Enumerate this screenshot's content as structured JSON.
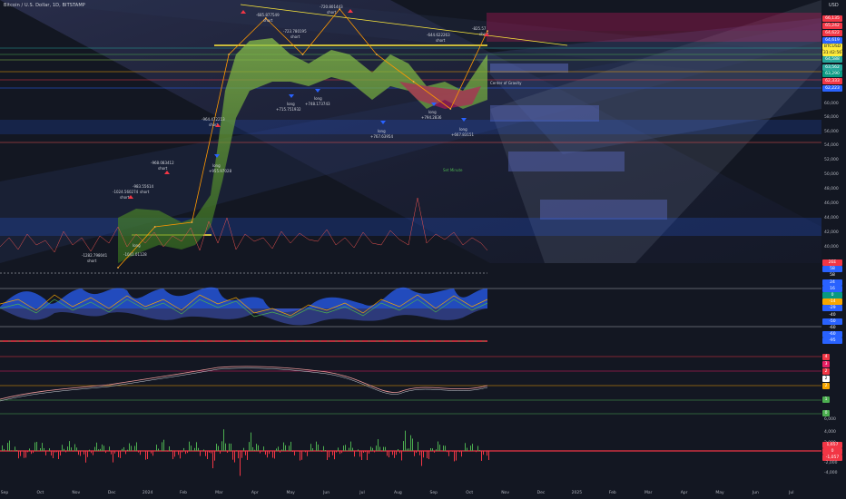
{
  "title": "Bitcoin / U.S. Dollar, 1D, BITSTAMP",
  "currency": "USD",
  "badges": [
    {
      "text": "66,135",
      "color": "#f23645"
    },
    {
      "text": "65,242",
      "color": "#f23645"
    },
    {
      "text": "64,622",
      "color": "#f23645"
    },
    {
      "text": "64,619",
      "color": "#2962ff"
    },
    {
      "text": "BTCUSD",
      "color": "#131722"
    },
    {
      "text": "64,588",
      "color": "#26a69a"
    },
    {
      "text": "63,562",
      "color": "#26a69a"
    },
    {
      "text": "63,290",
      "color": "#089981"
    },
    {
      "text": "62,333",
      "color": "#f23645"
    },
    {
      "text": "62,223",
      "color": "#2962ff"
    }
  ],
  "timer": "31:42:56",
  "price_ticks": [
    "60,000",
    "58,000",
    "56,000",
    "54,000",
    "52,000",
    "50,000",
    "48,000",
    "46,000",
    "44,000",
    "42,000",
    "40,000"
  ],
  "osc_badges": [
    {
      "text": "2EE",
      "color": "#f23645"
    },
    {
      "text": "58",
      "color": "#2962ff"
    },
    {
      "text": "58",
      "color": "#131722"
    },
    {
      "text": "24",
      "color": "#2962ff"
    },
    {
      "text": "16",
      "color": "#2962ff"
    },
    {
      "text": "0",
      "color": "#089981"
    },
    {
      "text": "-14",
      "color": "#f7a600"
    },
    {
      "text": "-29",
      "color": "#2962ff"
    },
    {
      "text": "-40",
      "color": "#131722"
    },
    {
      "text": "-50",
      "color": "#2962ff"
    },
    {
      "text": "-60",
      "color": "#131722"
    },
    {
      "text": "-60",
      "color": "#2962ff"
    },
    {
      "text": "-95",
      "color": "#2962ff"
    }
  ],
  "num_badges": [
    {
      "text": "4",
      "color": "#f23645"
    },
    {
      "text": "3",
      "color": "#e91e63"
    },
    {
      "text": "2",
      "color": "#f23645"
    },
    {
      "text": "2",
      "color": "#ffffff"
    },
    {
      "text": "2",
      "color": "#f7a600"
    },
    {
      "text": "1",
      "color": "#4caf50"
    },
    {
      "text": "0",
      "color": "#4caf50"
    }
  ],
  "vol_ticks": [
    "4,000",
    "2,000",
    "0",
    "-2,000",
    "-4,000"
  ],
  "vol_badges": [
    {
      "text": "1,657",
      "color": "#f23645"
    },
    {
      "text": "0",
      "color": "#f23645"
    },
    {
      "text": "-1,057",
      "color": "#f23645"
    }
  ],
  "stoch_tick": "6,000",
  "x_ticks": [
    "Sep",
    "Oct",
    "Nov",
    "Dec",
    "2024",
    "Feb",
    "Mar",
    "Apr",
    "May",
    "Jun",
    "Jul",
    "Aug",
    "Sep",
    "Oct",
    "Nov",
    "Dec",
    "2025",
    "Feb",
    "Mar",
    "Apr",
    "May",
    "Jun",
    "Jul"
  ],
  "annotations": [
    {
      "text": "short",
      "a": "-1282.798041"
    },
    {
      "text": "short",
      "a": "-1024.560274"
    },
    {
      "text": "short",
      "a": "-983.55614"
    },
    {
      "text": "short",
      "a": "-968.083412"
    },
    {
      "text": "short",
      "a": "-964.472213"
    },
    {
      "text": "short",
      "a": "-685.877549"
    },
    {
      "text": "short",
      "a": "-720.801443"
    },
    {
      "text": "short",
      "a": "-723.780195"
    },
    {
      "text": "short",
      "a": "-644.622263"
    },
    {
      "text": "short",
      "a": "-825.57"
    },
    {
      "text": "long",
      "a": "+955.97028"
    },
    {
      "text": "long",
      "a": "+715.751932"
    },
    {
      "text": "long",
      "a": "+748.173743"
    },
    {
      "text": "long",
      "a": "+767.63954"
    },
    {
      "text": "long",
      "a": "+794.2836"
    },
    {
      "text": "long",
      "a": "+667.83151"
    },
    {
      "text": "long",
      "a": "-1041.01128"
    }
  ],
  "zone_labels": [
    "Center of Gravity",
    "Set Minute"
  ],
  "chart_data": {
    "type": "line",
    "title": "Bitcoin / U.S. Dollar, 1D, BITSTAMP",
    "xlabel": "",
    "ylabel": "USD",
    "ylim": [
      39000,
      67500
    ],
    "x": [
      "Dec",
      "2024",
      "Feb",
      "Mar",
      "Apr",
      "May",
      "Jun",
      "Jul",
      "Aug",
      "Sep",
      "Oct"
    ],
    "series": [
      {
        "name": "BTCUSD",
        "values": [
          38500,
          43000,
          43500,
          62000,
          66000,
          62000,
          67000,
          62000,
          59000,
          56000,
          64588
        ]
      }
    ],
    "grid": true,
    "legend": "none"
  }
}
